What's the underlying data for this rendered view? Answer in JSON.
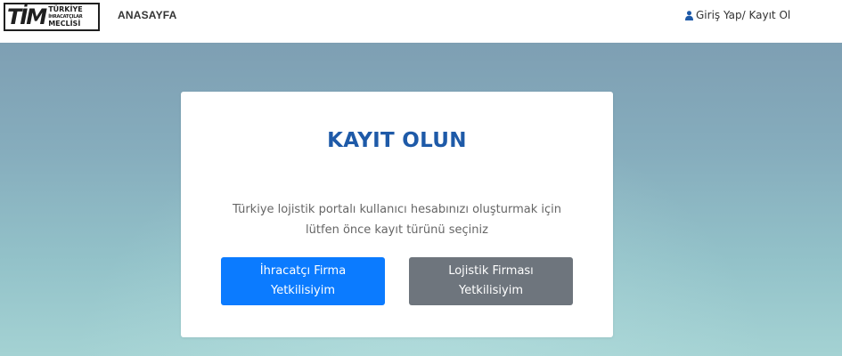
{
  "header": {
    "logo": {
      "mark": "TİM",
      "line1": "TÜRKİYE",
      "line2": "İHRACATÇILAR",
      "line3": "MECLİSİ"
    },
    "nav_home": "ANASAYFA",
    "login_link": "Giriş Yap/ Kayıt Ol",
    "login_icon": "user-icon"
  },
  "card": {
    "title": "KAYIT OLUN",
    "description": "Türkiye lojistik portalı kullanıcı hesabınızı oluşturmak için lütfen önce kayıt türünü seçiniz",
    "buttons": {
      "exporter": "İhracatçı Firma Yetkilisiyim",
      "logistics": "Lojistik Firması Yetkilisiyim"
    }
  },
  "colors": {
    "title": "#1e5aa8",
    "primary_button": "#0b7bff",
    "secondary_button": "#6e757d",
    "user_icon": "#1e5aa8"
  }
}
